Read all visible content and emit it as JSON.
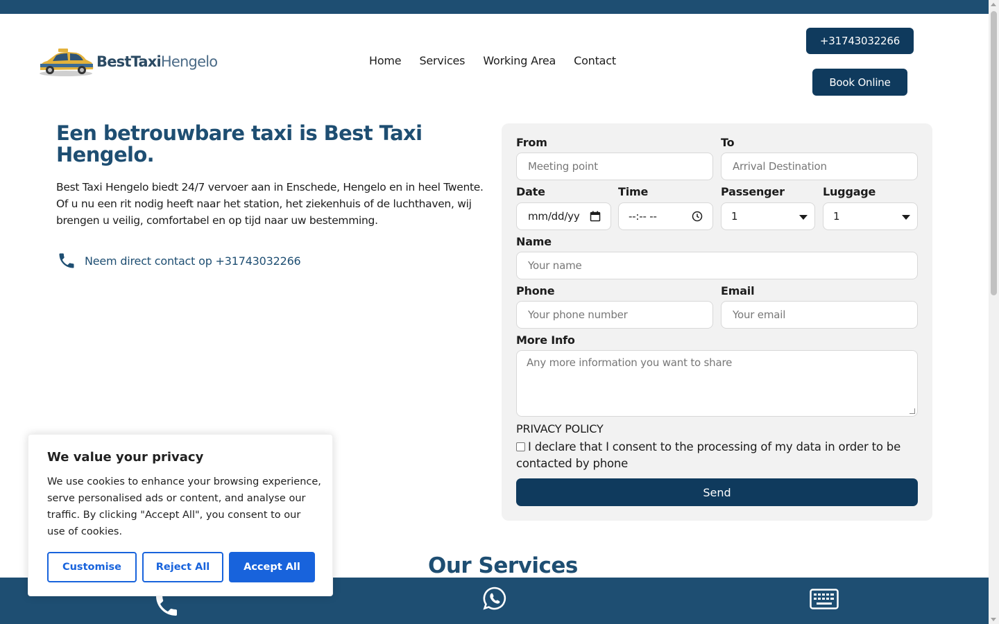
{
  "brand": {
    "name_part1": "BestTaxi",
    "name_part2": "Hengelo"
  },
  "nav": {
    "items": [
      "Home",
      "Services",
      "Working Area",
      "Contact"
    ]
  },
  "header": {
    "phone_button": "+31743032266",
    "book_button": "Book Online"
  },
  "hero": {
    "title": "Een betrouwbare taxi is Best Taxi Hengelo.",
    "text": "Best Taxi Hengelo biedt 24/7 vervoer aan in Enschede, Hengelo en in heel Twente. Of u nu een rit nodig heeft naar het station, het ziekenhuis of de luchthaven, wij brengen u veilig, comfortabel en op tijd naar uw bestemming.",
    "contact_text": "Neem direct contact op +31743032266"
  },
  "form": {
    "from_label": "From",
    "from_placeholder": "Meeting point",
    "to_label": "To",
    "to_placeholder": "Arrival Destination",
    "date_label": "Date",
    "date_value": "mm/dd/yy",
    "time_label": "Time",
    "time_value": "--:-- --",
    "passenger_label": "Passenger",
    "passenger_value": "1",
    "luggage_label": "Luggage",
    "luggage_value": "1",
    "name_label": "Name",
    "name_placeholder": "Your name",
    "phone_label": "Phone",
    "phone_placeholder": "Your phone number",
    "email_label": "Email",
    "email_placeholder": "Your email",
    "info_label": "More Info",
    "info_placeholder": "Any more information you want to share",
    "privacy_heading": "PRIVACY POLICY",
    "consent_text": "I declare that I consent to the processing of my data in order to be contacted by phone",
    "send_button": "Send"
  },
  "services": {
    "heading": "Our Services"
  },
  "cookie": {
    "title": "We value your privacy",
    "text": "We use cookies to enhance your browsing experience, serve personalised ads or content, and analyse our traffic. By clicking \"Accept All\", you consent to our use of cookies.",
    "customise": "Customise",
    "reject": "Reject All",
    "accept": "Accept All"
  },
  "colors": {
    "primary": "#1e4e72",
    "button_dark": "#0f3a5d",
    "cookie_blue": "#1863dc"
  },
  "icons": {
    "bottom_bar": [
      "phone-icon",
      "whatsapp-icon",
      "keyboard-icon"
    ]
  }
}
